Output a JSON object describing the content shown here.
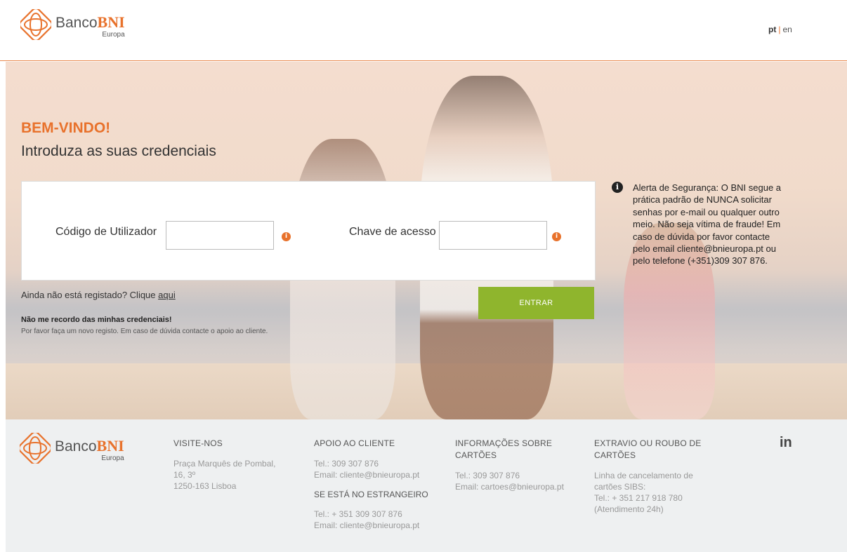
{
  "header": {
    "logo": {
      "brand_plain": "Banco",
      "brand_bold": "BNI",
      "sub": "Europa"
    },
    "lang_pt": "pt",
    "lang_sep": "|",
    "lang_en": "en"
  },
  "hero": {
    "welcome": "BEM-VINDO!",
    "subtitle": "Introduza as suas credenciais",
    "user_label": "Código de Utilizador",
    "user_value": "",
    "pass_label": "Chave de acesso",
    "pass_value": "",
    "info_glyph": "i",
    "register_text": "Ainda não está registado? Clique ",
    "register_link": "aqui",
    "submit_label": "ENTRAR",
    "forgot_title": "Não me recordo das minhas credenciais!",
    "forgot_text": "Por favor faça um novo registo. Em caso de dúvida contacte o apoio ao cliente."
  },
  "alert": {
    "icon": "info-icon",
    "text": "Alerta de Segurança: O BNI segue a prática padrão de NUNCA solicitar senhas por e-mail ou qualquer outro meio. Não seja vítima de fraude! Em caso de dúvida por favor contacte pelo email cliente@bnieuropa.pt ou pelo telefone  (+351)309 307 876."
  },
  "footer": {
    "visite": {
      "title": "VISITE-NOS",
      "line1": "Praça Marquês de Pombal,",
      "line2": "16, 3º",
      "line3": "1250-163 Lisboa"
    },
    "apoio": {
      "title": "APOIO AO CLIENTE",
      "tel": "Tel.: 309 307 876",
      "email": "Email: cliente@bnieuropa.pt",
      "abroad_title": "SE ESTÁ NO ESTRANGEIRO",
      "abroad_tel": "Tel.: + 351 309 307 876",
      "abroad_email": "Email: cliente@bnieuropa.pt"
    },
    "cartoes": {
      "title1": "INFORMAÇÕES SOBRE",
      "title2": "CARTÕES",
      "tel": "Tel.: 309 307 876",
      "email": "Email: cartoes@bnieuropa.pt"
    },
    "extravio": {
      "title1": "EXTRAVIO OU ROUBO DE",
      "title2": "CARTÕES",
      "line1": "Linha de cancelamento de",
      "line2": "cartões SIBS:",
      "line3": "Tel.: + 351 217 918 780",
      "line4": "(Atendimento 24h)"
    },
    "social": "in"
  },
  "colors": {
    "accent": "#e8722c",
    "button": "#8fb52d",
    "footer_bg": "#eef0f1"
  }
}
